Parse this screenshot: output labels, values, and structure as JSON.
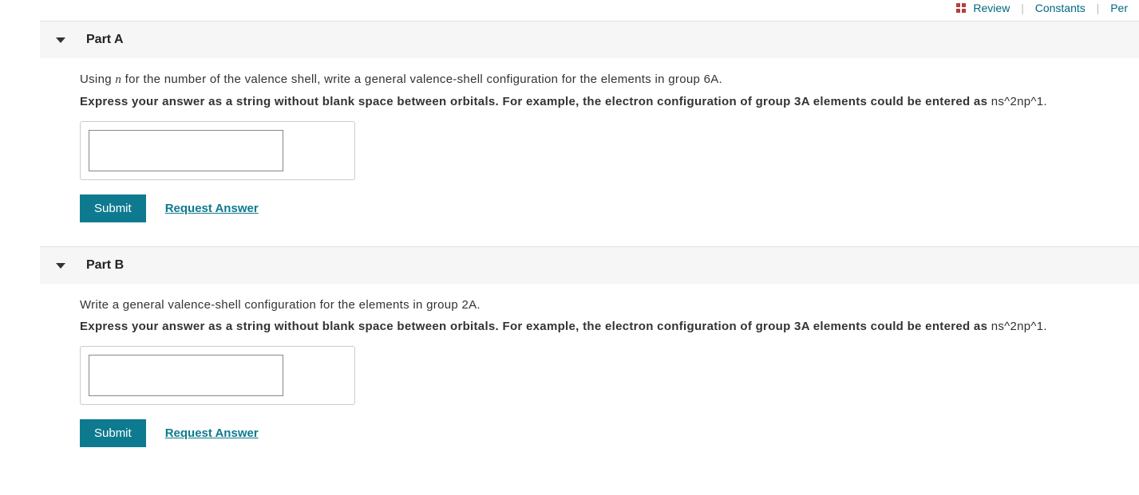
{
  "topLinks": {
    "review": "Review",
    "constants": "Constants",
    "periodic": "Per"
  },
  "parts": [
    {
      "title": "Part A",
      "question_pre": "Using ",
      "question_var": "n",
      "question_post": " for the number of the valence shell, write a general valence-shell configuration for the elements in group 6A.",
      "hint_main": "Express your answer as a string without blank space between orbitals. For example, the electron configuration of group 3A elements could be entered as ",
      "hint_example": "ns^2np^1.",
      "submit": "Submit",
      "request": "Request Answer",
      "input_value": ""
    },
    {
      "title": "Part B",
      "question": "Write a general valence-shell configuration for the elements in group 2A.",
      "hint_main": "Express your answer as a string without blank space between orbitals. For example, the electron configuration of group 3A elements could be entered as ",
      "hint_example": "ns^2np^1.",
      "submit": "Submit",
      "request": "Request Answer",
      "input_value": ""
    }
  ]
}
